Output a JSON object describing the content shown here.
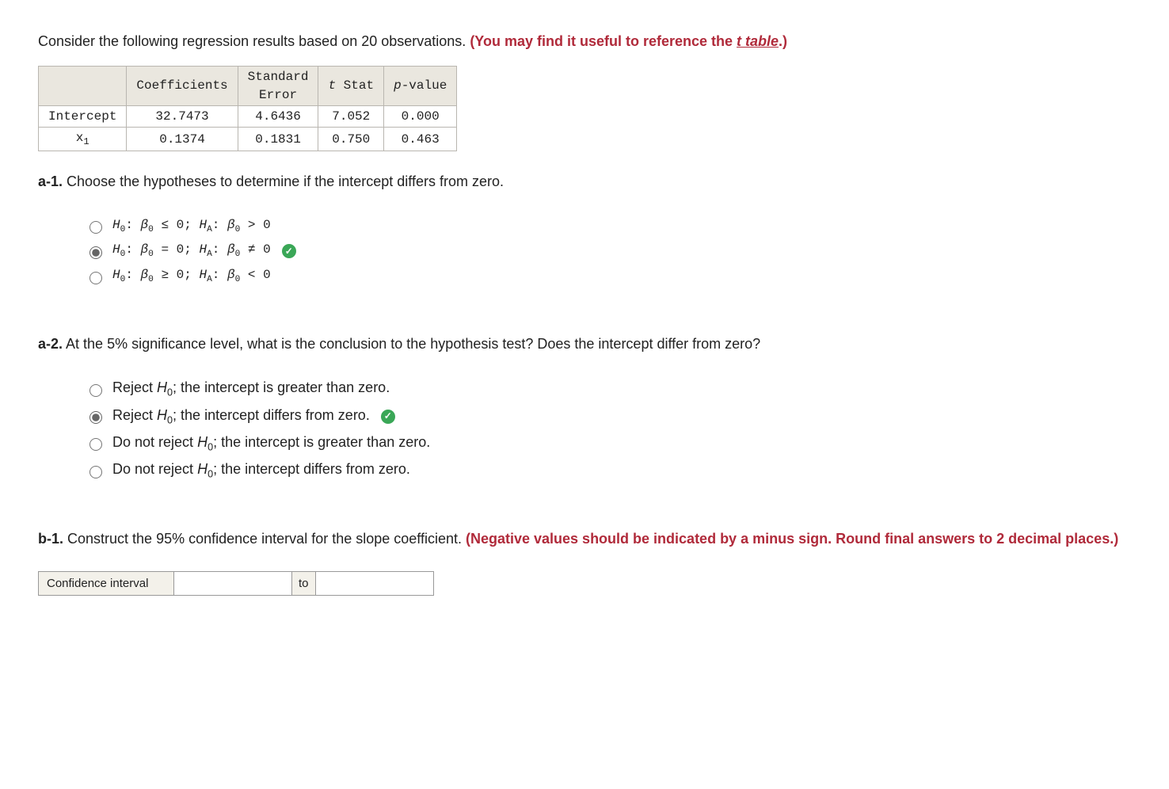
{
  "intro": {
    "text": "Consider the following regression results based on 20 observations. ",
    "hint_pre": "(You may find it useful to reference the ",
    "link": "t table",
    "hint_post": ".)"
  },
  "table": {
    "headers": [
      "",
      "Coefficients",
      "Standard Error",
      "t Stat",
      "p-value"
    ],
    "rows": [
      {
        "label": "Intercept",
        "coef": "32.7473",
        "se": "4.6436",
        "t": "7.052",
        "p": "0.000"
      },
      {
        "label": "x1",
        "coef": "0.1374",
        "se": "0.1831",
        "t": "0.750",
        "p": "0.463"
      }
    ]
  },
  "a1": {
    "num": "a-1.",
    "text": " Choose the hypotheses to determine if the intercept differs from zero.",
    "options": [
      {
        "sel": false,
        "correct": false,
        "h0rel": "≤",
        "harel": ">"
      },
      {
        "sel": true,
        "correct": true,
        "h0rel": "=",
        "harel": "≠"
      },
      {
        "sel": false,
        "correct": false,
        "h0rel": "≥",
        "harel": "<"
      }
    ]
  },
  "a2": {
    "num": "a-2.",
    "text": " At the 5% significance level, what is the conclusion to the hypothesis test? Does the intercept differ from zero?",
    "options": [
      {
        "sel": false,
        "correct": false,
        "pre": "Reject ",
        "post": "; the intercept is greater than zero."
      },
      {
        "sel": true,
        "correct": true,
        "pre": "Reject ",
        "post": "; the intercept differs from zero."
      },
      {
        "sel": false,
        "correct": false,
        "pre": "Do not reject ",
        "post": "; the intercept is greater than zero."
      },
      {
        "sel": false,
        "correct": false,
        "pre": "Do not reject ",
        "post": "; the intercept differs from zero."
      }
    ],
    "h0sym": "H0"
  },
  "b1": {
    "num": "b-1.",
    "text": " Construct the 95% confidence interval for the slope coefficient. ",
    "hint": "(Negative values should be indicated by a minus sign. Round final answers to 2 decimal places.)",
    "ci_label": "Confidence interval",
    "sep": "to",
    "low": "",
    "high": ""
  }
}
